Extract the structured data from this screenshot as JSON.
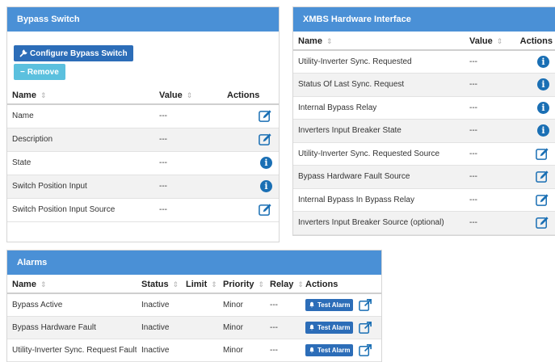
{
  "bypass": {
    "title": "Bypass Switch",
    "configure_label": "Configure Bypass Switch",
    "remove_label": "Remove",
    "headers": {
      "name": "Name",
      "value": "Value",
      "actions": "Actions"
    },
    "rows": [
      {
        "name": "Name",
        "value": "---",
        "action": "edit"
      },
      {
        "name": "Description",
        "value": "---",
        "action": "edit"
      },
      {
        "name": "State",
        "value": "---",
        "action": "info"
      },
      {
        "name": "Switch Position Input",
        "value": "---",
        "action": "info"
      },
      {
        "name": "Switch Position Input Source",
        "value": "---",
        "action": "edit"
      }
    ]
  },
  "xmbs": {
    "title": "XMBS Hardware Interface",
    "headers": {
      "name": "Name",
      "value": "Value",
      "actions": "Actions"
    },
    "rows": [
      {
        "name": "Utility-Inverter Sync. Requested",
        "value": "---",
        "action": "info"
      },
      {
        "name": "Status Of Last Sync. Request",
        "value": "---",
        "action": "info"
      },
      {
        "name": "Internal Bypass Relay",
        "value": "---",
        "action": "info"
      },
      {
        "name": "Inverters Input Breaker State",
        "value": "---",
        "action": "info"
      },
      {
        "name": "Utility-Inverter Sync. Requested Source",
        "value": "---",
        "action": "edit"
      },
      {
        "name": "Bypass Hardware Fault Source",
        "value": "---",
        "action": "edit"
      },
      {
        "name": "Internal Bypass In Bypass Relay",
        "value": "---",
        "action": "edit"
      },
      {
        "name": "Inverters Input Breaker Source (optional)",
        "value": "---",
        "action": "edit"
      }
    ]
  },
  "alarms": {
    "title": "Alarms",
    "headers": {
      "name": "Name",
      "status": "Status",
      "limit": "Limit",
      "priority": "Priority",
      "relay": "Relay",
      "actions": "Actions"
    },
    "test_label": "Test Alarm",
    "rows": [
      {
        "name": "Bypass Active",
        "status": "Inactive",
        "limit": "",
        "priority": "Minor",
        "relay": "---"
      },
      {
        "name": "Bypass Hardware Fault",
        "status": "Inactive",
        "limit": "",
        "priority": "Minor",
        "relay": "---"
      },
      {
        "name": "Utility-Inverter Sync. Request Fault",
        "status": "Inactive",
        "limit": "",
        "priority": "Minor",
        "relay": "---"
      }
    ]
  },
  "colors": {
    "header_blue": "#4a90d6",
    "button_blue": "#2c6db8",
    "remove_cyan": "#5bc0de",
    "icon_blue": "#1a6fb4"
  },
  "sort_glyph": "⇕",
  "info_glyph": "i"
}
